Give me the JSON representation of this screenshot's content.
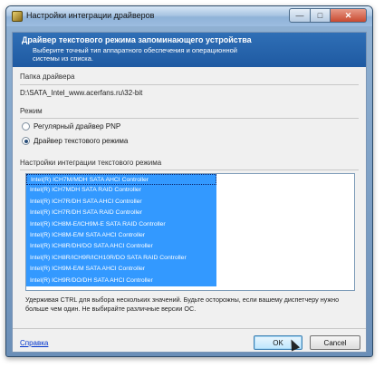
{
  "window": {
    "title": "Настройки интеграции драйверов",
    "controls": {
      "minimize": "—",
      "maximize": "□",
      "close": "✕"
    }
  },
  "header": {
    "title": "Драйвер текстового режима запоминающего устройства",
    "description": "Выберите точный тип аппаратного обеспечения и операционной системы из списка."
  },
  "driver_folder": {
    "label": "Папка драйвера",
    "path": "D:\\SATA_Intel_www.acerfans.ru\\32-bit"
  },
  "mode": {
    "label": "Режим",
    "options": [
      {
        "label": "Регулярный драйвер PNP",
        "selected": false
      },
      {
        "label": "Драйвер текстового режима",
        "selected": true
      }
    ]
  },
  "text_mode": {
    "label": "Настройки интеграции текстового режима",
    "items": [
      "Intel(R) ICH7M/MDH SATA AHCI Controller",
      "Intel(R) ICH7MDH SATA RAID Controller",
      "Intel(R) ICH7R/DH SATA AHCI Controller",
      "Intel(R) ICH7R/DH SATA RAID Controller",
      "Intel(R) ICH8M-E/ICH9M-E SATA RAID Controller",
      "Intel(R) ICH8M-E/M SATA AHCI Controller",
      "Intel(R) ICH8R/DH/DO SATA AHCI Controller",
      "Intel(R) ICH8R/ICH9R/ICH10R/DO SATA RAID Controller",
      "Intel(R) ICH9M-E/M SATA AHCI Controller",
      "Intel(R) ICH9R/DO/DH SATA AHCI Controller"
    ],
    "hint": "Удерживая CTRL для выбора нескольких значений. Будьте осторожны, если вашему диспетчеру нужно больше чем один. Не выбирайте различные версии ОС."
  },
  "footer": {
    "help_link": "Справка",
    "ok_label": "OK",
    "cancel_label": "Cancel"
  },
  "colors": {
    "accent": "#3399ff",
    "header_band": "#2566ad"
  }
}
